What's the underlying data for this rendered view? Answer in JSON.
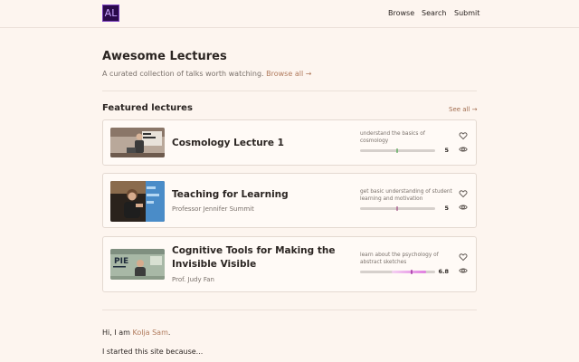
{
  "header": {
    "logo_text": "AL",
    "nav": [
      "Browse",
      "Search",
      "Submit"
    ]
  },
  "hero": {
    "title": "Awesome Lectures",
    "subtitle": "A curated collection of talks worth watching.",
    "browse_link": "Browse all →"
  },
  "featured": {
    "title": "Featured lectures",
    "see_all": "See all →",
    "lectures": [
      {
        "title": "Cosmology Lecture 1",
        "speaker": "",
        "goal": "understand the basics of cosmology",
        "score": "5",
        "score_value": 5,
        "score_max": 10,
        "bar_color": "#7db87a",
        "icons": [
          "heart-icon",
          "eye-icon"
        ]
      },
      {
        "title": "Teaching for Learning",
        "speaker": "Professor Jennifer Summit",
        "goal": "get basic understanding of student learning and motivation",
        "score": "5",
        "score_value": 5,
        "score_max": 10,
        "bar_color": "#b87aa0",
        "icons": [
          "heart-icon",
          "eye-icon"
        ]
      },
      {
        "title": "Cognitive Tools for Making the Invisible Visible",
        "speaker": "Prof. Judy Fan",
        "goal": "learn about the psychology of abstract sketches",
        "score": "6.8",
        "score_value": 6.8,
        "score_max": 10,
        "bar_color": "#e48ae0",
        "icons": [
          "heart-icon",
          "eye-icon"
        ]
      }
    ]
  },
  "intro": {
    "greeting_prefix": "Hi, I am ",
    "name": "Kolja Sam",
    "greeting_suffix": ".",
    "reason": "I started this site because..."
  },
  "colors": {
    "background": "#fdf5ef",
    "link": "#b07a5c",
    "logo_bg": "#2a0a4a"
  }
}
